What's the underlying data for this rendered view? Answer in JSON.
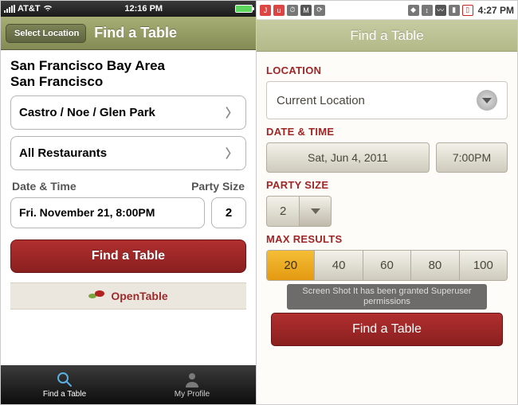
{
  "ios": {
    "status": {
      "carrier": "AT&T",
      "time": "12:16 PM"
    },
    "nav": {
      "back": "Select Location",
      "title": "Find a Table"
    },
    "location_metro": "San Francisco Bay Area",
    "location_city": "San Francisco",
    "neighborhood": "Castro / Noe / Glen Park",
    "restaurants": "All Restaurants",
    "labels": {
      "datetime": "Date & Time",
      "party": "Party Size"
    },
    "datetime": "Fri. November 21, 8:00PM",
    "party": "2",
    "find": "Find a Table",
    "brand": "OpenTable",
    "tabs": {
      "find": "Find a Table",
      "profile": "My Profile"
    }
  },
  "android": {
    "status": {
      "time": "4:27 PM"
    },
    "nav_title": "Find a Table",
    "labels": {
      "location": "LOCATION",
      "datetime": "DATE & TIME",
      "party": "PARTY SIZE",
      "max": "MAX RESULTS"
    },
    "location": "Current Location",
    "date": "Sat, Jun 4, 2011",
    "time": "7:00PM",
    "party": "2",
    "max_options": [
      "20",
      "40",
      "60",
      "80",
      "100"
    ],
    "max_selected": "20",
    "toast": "Screen Shot It has been granted Superuser permissions",
    "find": "Find a Table"
  }
}
